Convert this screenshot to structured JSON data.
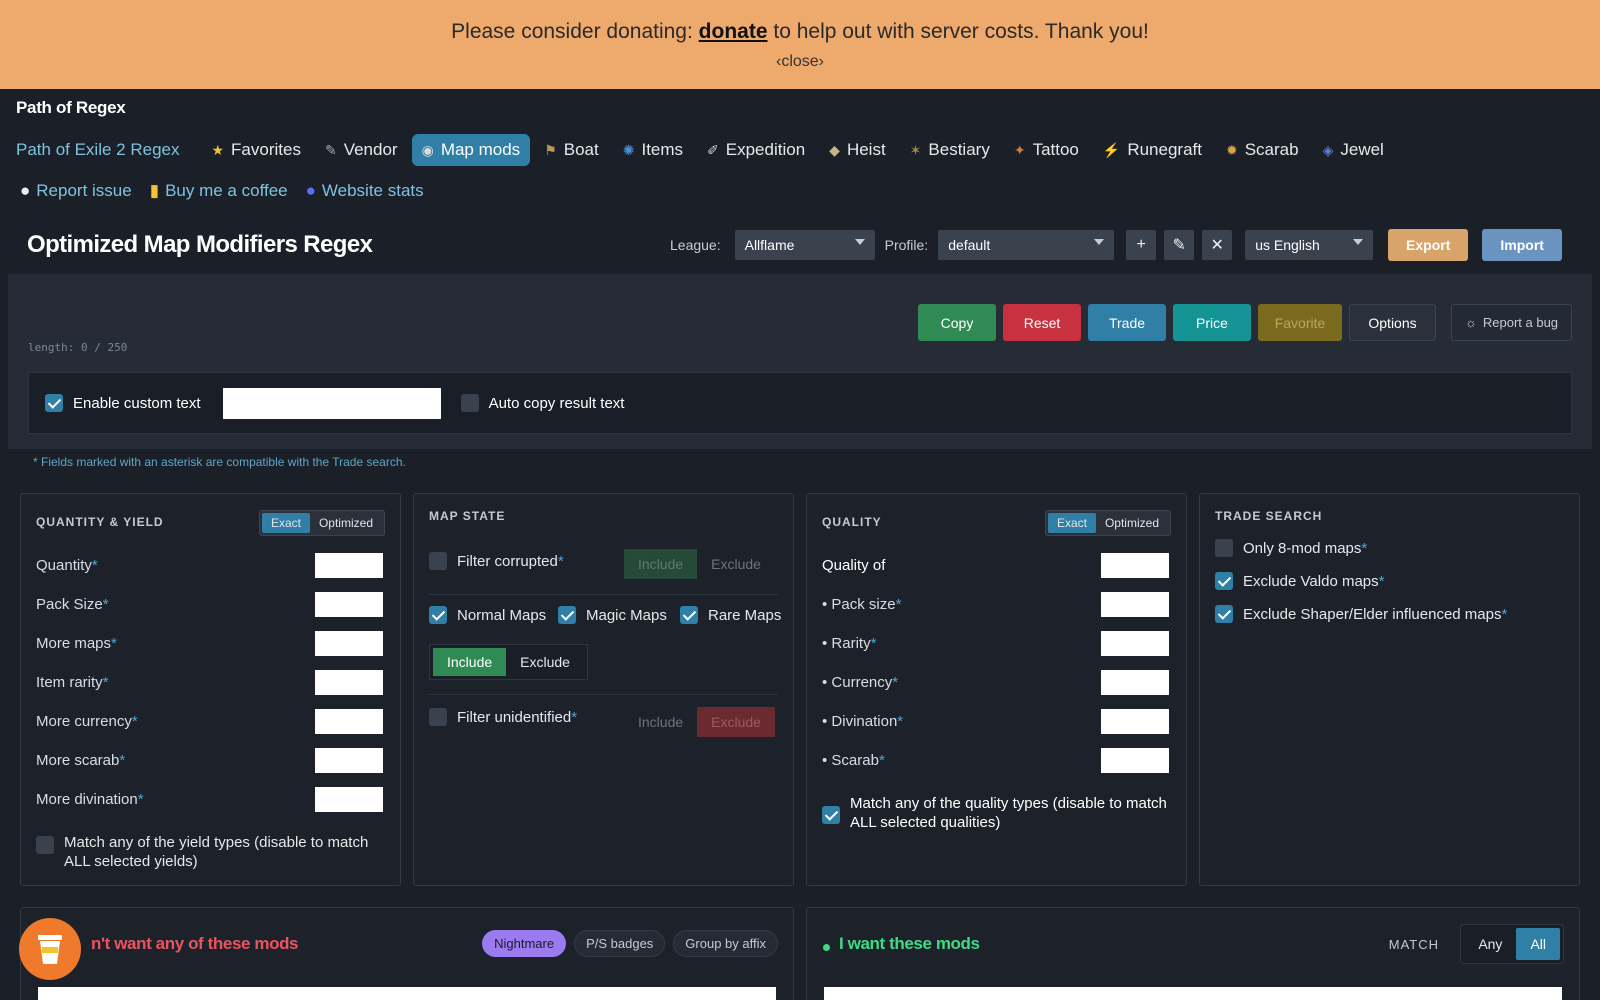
{
  "banner": {
    "prefix": "Please consider donating:",
    "link": "donate",
    "suffix": "to help out with server costs. Thank you!",
    "close": "‹close›"
  },
  "brand": "Path of Regex",
  "nav": {
    "poe2": "Path of Exile 2 Regex",
    "items": [
      {
        "label": "Favorites",
        "icon": "star-icon",
        "glyph": "★"
      },
      {
        "label": "Vendor",
        "icon": "vendor-icon",
        "glyph": "✎"
      },
      {
        "label": "Map mods",
        "icon": "map-icon",
        "glyph": "◉"
      },
      {
        "label": "Boat",
        "icon": "boat-icon",
        "glyph": "⚑"
      },
      {
        "label": "Items",
        "icon": "items-icon",
        "glyph": "✺"
      },
      {
        "label": "Expedition",
        "icon": "expedition-icon",
        "glyph": "✐"
      },
      {
        "label": "Heist",
        "icon": "heist-icon",
        "glyph": "◆"
      },
      {
        "label": "Bestiary",
        "icon": "bestiary-icon",
        "glyph": "✶"
      },
      {
        "label": "Tattoo",
        "icon": "tattoo-icon",
        "glyph": "✦"
      },
      {
        "label": "Runegraft",
        "icon": "runegraft-icon",
        "glyph": "⚡"
      },
      {
        "label": "Scarab",
        "icon": "scarab-icon",
        "glyph": "✹"
      },
      {
        "label": "Jewel",
        "icon": "jewel-icon",
        "glyph": "◈"
      }
    ],
    "secondary": [
      {
        "label": "Report issue",
        "icon": "github-icon",
        "glyph": "●"
      },
      {
        "label": "Buy me a coffee",
        "icon": "coffee-icon",
        "glyph": "▮"
      },
      {
        "label": "Website stats",
        "icon": "stats-icon",
        "glyph": "●"
      }
    ]
  },
  "page_title": "Optimized Map Modifiers Regex",
  "controls": {
    "league_label": "League:",
    "league_value": "Allflame",
    "profile_label": "Profile:",
    "profile_value": "default",
    "add": "+",
    "edit": "✎",
    "delete": "✕",
    "language": "us English",
    "export": "Export",
    "import": "Import"
  },
  "actions": {
    "copy": "Copy",
    "reset": "Reset",
    "trade": "Trade",
    "price": "Price",
    "favorite": "Favorite",
    "options": "Options",
    "bug": "Report a bug",
    "bug_glyph": "☼"
  },
  "length": "length: 0 / 250",
  "custom": {
    "enable": "Enable custom text",
    "enable_checked": true,
    "auto_copy": "Auto copy result text",
    "auto_copy_checked": false,
    "text_value": ""
  },
  "note": "* Fields marked with an asterisk are compatible with the Trade search.",
  "quantity": {
    "title": "QUANTITY & YIELD",
    "exact": "Exact",
    "optimized": "Optimized",
    "fields": [
      "Quantity",
      "Pack Size",
      "More maps",
      "Item rarity",
      "More currency",
      "More scarab",
      "More divination"
    ],
    "match_any": "Match any of the yield types (disable to match",
    "match_any2": "ALL selected yields)",
    "match_any_checked": false
  },
  "map_state": {
    "title": "MAP STATE",
    "filter_corrupted": "Filter corrupted",
    "include": "Include",
    "exclude": "Exclude",
    "normal": "Normal Maps",
    "magic": "Magic Maps",
    "rare": "Rare Maps",
    "filter_unidentified": "Filter unidentified"
  },
  "quality": {
    "title": "QUALITY",
    "exact": "Exact",
    "optimized": "Optimized",
    "quality_of": "Quality of",
    "fields": [
      "• Pack size",
      "• Rarity",
      "• Currency",
      "• Divination",
      "• Scarab"
    ],
    "match_any": "Match any of the quality types (disable to match",
    "match_any2": "ALL selected qualities)",
    "match_any_checked": true
  },
  "trade": {
    "title": "TRADE SEARCH",
    "only8": "Only 8-mod maps",
    "only8_checked": false,
    "valdo": "Exclude Valdo maps",
    "valdo_checked": true,
    "shaper": "Exclude Shaper/Elder influenced maps",
    "shaper_checked": true
  },
  "bottom": {
    "dont_want": "n't want any of these mods",
    "nightmare": "Nightmare",
    "ps_badges": "P/S badges",
    "group_affix": "Group by affix",
    "want": "I want these mods",
    "match": "MATCH",
    "any": "Any",
    "all": "All"
  },
  "asterisk": "*"
}
